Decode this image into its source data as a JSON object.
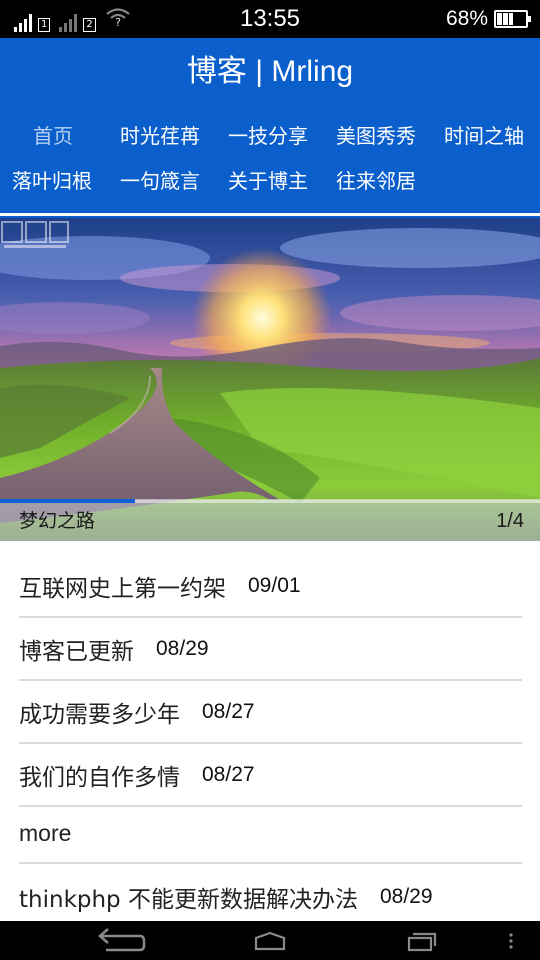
{
  "status_bar": {
    "time": "13:55",
    "battery_percent_text": "68%",
    "battery_level": 0.68,
    "sim_1_label": "1",
    "sim_2_label": "2",
    "network_label": "H",
    "wifi_label": "?",
    "icons": [
      "signal-icon",
      "signal-icon",
      "wifi-icon",
      "battery-icon"
    ]
  },
  "header": {
    "title": "博客 | Mrling",
    "nav_rows": [
      [
        "首页",
        "时光荏苒",
        "一技分享",
        "美图秀秀",
        "时间之轴"
      ],
      [
        "落叶归根",
        "一句箴言",
        "关于博主",
        "往来邻居"
      ]
    ],
    "active_nav": "首页",
    "accent_color": "#0a5fcc",
    "active_color": "#b8d0f4"
  },
  "banner": {
    "caption": "梦幻之路",
    "counter": "1/4",
    "slide_index": 1,
    "slide_total": 4,
    "progress_fraction": 0.25
  },
  "articles": [
    {
      "title": "互联网史上第一约架",
      "date": "09/01"
    },
    {
      "title": "博客已更新",
      "date": "08/29"
    },
    {
      "title": "成功需要多少年",
      "date": "08/27"
    },
    {
      "title": "我们的自作多情",
      "date": "08/27"
    },
    {
      "title": "more",
      "date": ""
    },
    {
      "title": "thinkphp 不能更新数据解决办法",
      "date": "08/29"
    }
  ],
  "system_nav": {
    "icons": [
      "back-icon",
      "home-icon",
      "recent-apps-icon",
      "menu-icon"
    ]
  }
}
